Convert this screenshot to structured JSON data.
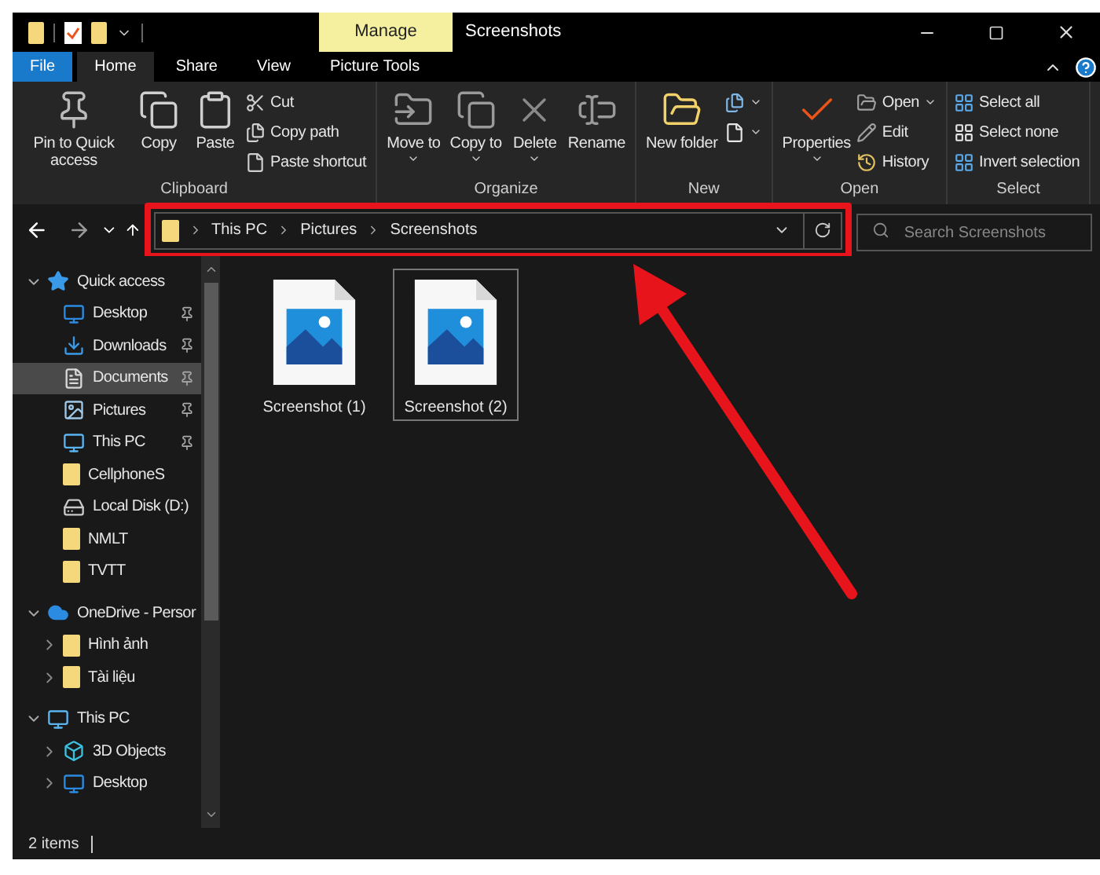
{
  "title_bar": {
    "context_tab": "Manage",
    "title": "Screenshots"
  },
  "ribbon_tabs": [
    {
      "label": "File",
      "kind": "file",
      "selected": false
    },
    {
      "label": "Home",
      "kind": "tab",
      "selected": true
    },
    {
      "label": "Share",
      "kind": "tab",
      "selected": false
    },
    {
      "label": "View",
      "kind": "tab",
      "selected": false
    },
    {
      "label": "Picture Tools",
      "kind": "context",
      "selected": false
    }
  ],
  "ribbon_groups": [
    {
      "label": "Clipboard",
      "items": [
        {
          "kind": "large",
          "label": "Pin to Quick access"
        },
        {
          "kind": "large",
          "label": "Copy"
        },
        {
          "kind": "large",
          "label": "Paste"
        },
        {
          "kind": "small",
          "label": "Cut"
        },
        {
          "kind": "small",
          "label": "Copy path"
        },
        {
          "kind": "small",
          "label": "Paste shortcut"
        }
      ]
    },
    {
      "label": "Organize",
      "items": [
        {
          "kind": "large",
          "label": "Move to",
          "dropdown": true
        },
        {
          "kind": "large",
          "label": "Copy to",
          "dropdown": true
        },
        {
          "kind": "large",
          "label": "Delete",
          "dropdown": true
        },
        {
          "kind": "large",
          "label": "Rename"
        }
      ]
    },
    {
      "label": "New",
      "items": [
        {
          "kind": "large",
          "label": "New folder"
        },
        {
          "kind": "icon",
          "dropdown": true
        },
        {
          "kind": "icon",
          "dropdown": true
        }
      ]
    },
    {
      "label": "Open",
      "items": [
        {
          "kind": "large",
          "label": "Properties",
          "dropdown": true
        },
        {
          "kind": "small",
          "label": "Open",
          "dropdown": true
        },
        {
          "kind": "small",
          "label": "Edit"
        },
        {
          "kind": "small",
          "label": "History"
        }
      ]
    },
    {
      "label": "Select",
      "items": [
        {
          "kind": "small",
          "label": "Select all"
        },
        {
          "kind": "small",
          "label": "Select none"
        },
        {
          "kind": "small",
          "label": "Invert selection"
        }
      ]
    }
  ],
  "address_bar": {
    "segments": [
      "This PC",
      "Pictures",
      "Screenshots"
    ],
    "search_placeholder": "Search Screenshots"
  },
  "nav_tree": [
    {
      "label": "Quick access",
      "kind": "star",
      "expanded": true,
      "children": [
        {
          "label": "Desktop",
          "kind": "desktop",
          "pinned": true
        },
        {
          "label": "Downloads",
          "kind": "download",
          "pinned": true
        },
        {
          "label": "Documents",
          "kind": "document",
          "pinned": true,
          "selected": true
        },
        {
          "label": "Pictures",
          "kind": "pictures",
          "pinned": true
        },
        {
          "label": "This PC",
          "kind": "pc",
          "pinned": true
        },
        {
          "label": "CellphoneS",
          "kind": "folder",
          "pinned": false
        },
        {
          "label": "Local Disk (D:)",
          "kind": "drive",
          "pinned": false
        },
        {
          "label": "NMLT",
          "kind": "folder",
          "pinned": false
        },
        {
          "label": "TVTT",
          "kind": "folder",
          "pinned": false
        }
      ]
    },
    {
      "label": "OneDrive - Persor",
      "kind": "cloud",
      "expanded": true,
      "children": [
        {
          "label": "Hình ảnh",
          "kind": "folder",
          "expanded": false
        },
        {
          "label": "Tài liệu",
          "kind": "folder",
          "expanded": false
        }
      ]
    },
    {
      "label": "This PC",
      "kind": "pc",
      "expanded": true,
      "children": [
        {
          "label": "3D Objects",
          "kind": "cube",
          "expanded": false
        },
        {
          "label": "Desktop",
          "kind": "desktop",
          "expanded": false
        }
      ]
    }
  ],
  "files": [
    {
      "name": "Screenshot (1)",
      "selected": false
    },
    {
      "name": "Screenshot (2)",
      "selected": true
    }
  ],
  "status_bar": {
    "item_count": "2 items"
  }
}
